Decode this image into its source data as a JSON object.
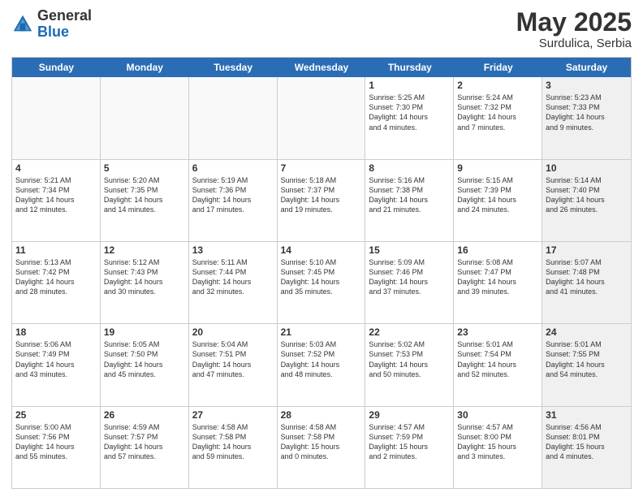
{
  "logo": {
    "general": "General",
    "blue": "Blue"
  },
  "title": "May 2025",
  "subtitle": "Surdulica, Serbia",
  "weekdays": [
    "Sunday",
    "Monday",
    "Tuesday",
    "Wednesday",
    "Thursday",
    "Friday",
    "Saturday"
  ],
  "rows": [
    [
      {
        "day": "",
        "detail": "",
        "empty": true
      },
      {
        "day": "",
        "detail": "",
        "empty": true
      },
      {
        "day": "",
        "detail": "",
        "empty": true
      },
      {
        "day": "",
        "detail": "",
        "empty": true
      },
      {
        "day": "1",
        "detail": "Sunrise: 5:25 AM\nSunset: 7:30 PM\nDaylight: 14 hours\nand 4 minutes."
      },
      {
        "day": "2",
        "detail": "Sunrise: 5:24 AM\nSunset: 7:32 PM\nDaylight: 14 hours\nand 7 minutes."
      },
      {
        "day": "3",
        "detail": "Sunrise: 5:23 AM\nSunset: 7:33 PM\nDaylight: 14 hours\nand 9 minutes.",
        "shaded": true
      }
    ],
    [
      {
        "day": "4",
        "detail": "Sunrise: 5:21 AM\nSunset: 7:34 PM\nDaylight: 14 hours\nand 12 minutes."
      },
      {
        "day": "5",
        "detail": "Sunrise: 5:20 AM\nSunset: 7:35 PM\nDaylight: 14 hours\nand 14 minutes."
      },
      {
        "day": "6",
        "detail": "Sunrise: 5:19 AM\nSunset: 7:36 PM\nDaylight: 14 hours\nand 17 minutes."
      },
      {
        "day": "7",
        "detail": "Sunrise: 5:18 AM\nSunset: 7:37 PM\nDaylight: 14 hours\nand 19 minutes."
      },
      {
        "day": "8",
        "detail": "Sunrise: 5:16 AM\nSunset: 7:38 PM\nDaylight: 14 hours\nand 21 minutes."
      },
      {
        "day": "9",
        "detail": "Sunrise: 5:15 AM\nSunset: 7:39 PM\nDaylight: 14 hours\nand 24 minutes."
      },
      {
        "day": "10",
        "detail": "Sunrise: 5:14 AM\nSunset: 7:40 PM\nDaylight: 14 hours\nand 26 minutes.",
        "shaded": true
      }
    ],
    [
      {
        "day": "11",
        "detail": "Sunrise: 5:13 AM\nSunset: 7:42 PM\nDaylight: 14 hours\nand 28 minutes."
      },
      {
        "day": "12",
        "detail": "Sunrise: 5:12 AM\nSunset: 7:43 PM\nDaylight: 14 hours\nand 30 minutes."
      },
      {
        "day": "13",
        "detail": "Sunrise: 5:11 AM\nSunset: 7:44 PM\nDaylight: 14 hours\nand 32 minutes."
      },
      {
        "day": "14",
        "detail": "Sunrise: 5:10 AM\nSunset: 7:45 PM\nDaylight: 14 hours\nand 35 minutes."
      },
      {
        "day": "15",
        "detail": "Sunrise: 5:09 AM\nSunset: 7:46 PM\nDaylight: 14 hours\nand 37 minutes."
      },
      {
        "day": "16",
        "detail": "Sunrise: 5:08 AM\nSunset: 7:47 PM\nDaylight: 14 hours\nand 39 minutes."
      },
      {
        "day": "17",
        "detail": "Sunrise: 5:07 AM\nSunset: 7:48 PM\nDaylight: 14 hours\nand 41 minutes.",
        "shaded": true
      }
    ],
    [
      {
        "day": "18",
        "detail": "Sunrise: 5:06 AM\nSunset: 7:49 PM\nDaylight: 14 hours\nand 43 minutes."
      },
      {
        "day": "19",
        "detail": "Sunrise: 5:05 AM\nSunset: 7:50 PM\nDaylight: 14 hours\nand 45 minutes."
      },
      {
        "day": "20",
        "detail": "Sunrise: 5:04 AM\nSunset: 7:51 PM\nDaylight: 14 hours\nand 47 minutes."
      },
      {
        "day": "21",
        "detail": "Sunrise: 5:03 AM\nSunset: 7:52 PM\nDaylight: 14 hours\nand 48 minutes."
      },
      {
        "day": "22",
        "detail": "Sunrise: 5:02 AM\nSunset: 7:53 PM\nDaylight: 14 hours\nand 50 minutes."
      },
      {
        "day": "23",
        "detail": "Sunrise: 5:01 AM\nSunset: 7:54 PM\nDaylight: 14 hours\nand 52 minutes."
      },
      {
        "day": "24",
        "detail": "Sunrise: 5:01 AM\nSunset: 7:55 PM\nDaylight: 14 hours\nand 54 minutes.",
        "shaded": true
      }
    ],
    [
      {
        "day": "25",
        "detail": "Sunrise: 5:00 AM\nSunset: 7:56 PM\nDaylight: 14 hours\nand 55 minutes."
      },
      {
        "day": "26",
        "detail": "Sunrise: 4:59 AM\nSunset: 7:57 PM\nDaylight: 14 hours\nand 57 minutes."
      },
      {
        "day": "27",
        "detail": "Sunrise: 4:58 AM\nSunset: 7:58 PM\nDaylight: 14 hours\nand 59 minutes."
      },
      {
        "day": "28",
        "detail": "Sunrise: 4:58 AM\nSunset: 7:58 PM\nDaylight: 15 hours\nand 0 minutes."
      },
      {
        "day": "29",
        "detail": "Sunrise: 4:57 AM\nSunset: 7:59 PM\nDaylight: 15 hours\nand 2 minutes."
      },
      {
        "day": "30",
        "detail": "Sunrise: 4:57 AM\nSunset: 8:00 PM\nDaylight: 15 hours\nand 3 minutes."
      },
      {
        "day": "31",
        "detail": "Sunrise: 4:56 AM\nSunset: 8:01 PM\nDaylight: 15 hours\nand 4 minutes.",
        "shaded": true
      }
    ]
  ]
}
